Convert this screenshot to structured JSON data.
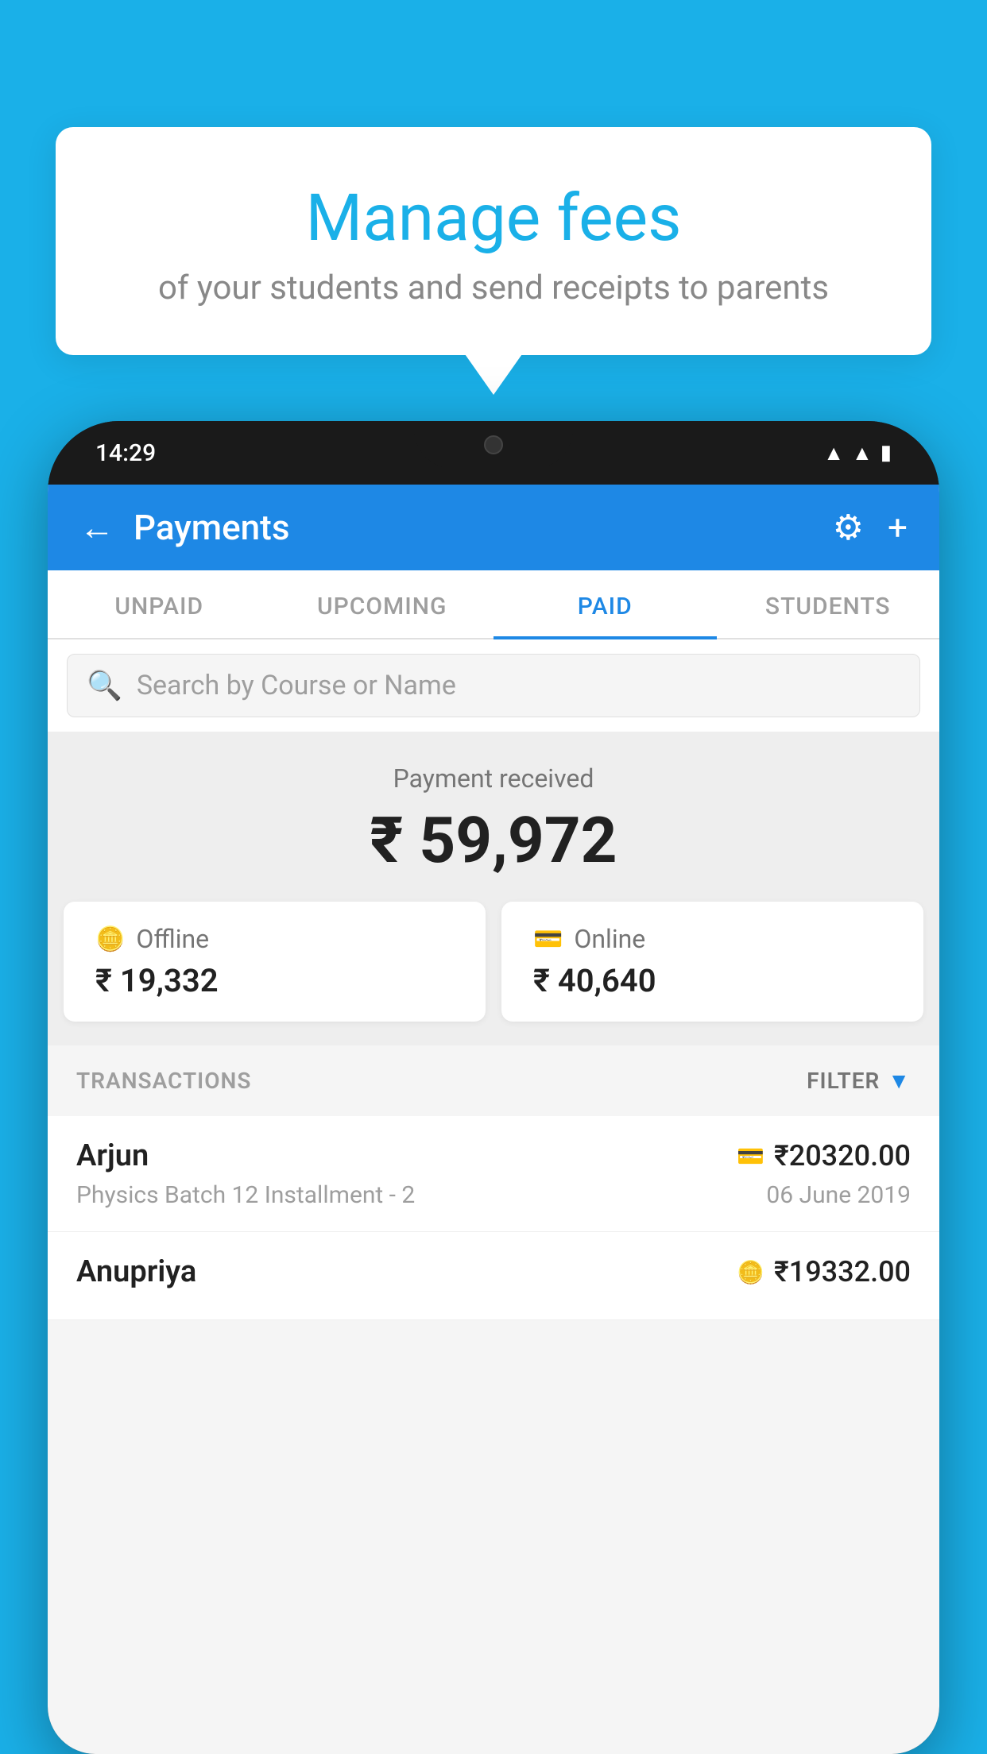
{
  "page": {
    "background_color": "#1ab0e8"
  },
  "tooltip": {
    "title": "Manage fees",
    "subtitle": "of your students and send receipts to parents"
  },
  "status_bar": {
    "time": "14:29"
  },
  "header": {
    "title": "Payments",
    "back_label": "←",
    "settings_label": "⚙",
    "add_label": "+"
  },
  "tabs": [
    {
      "label": "UNPAID",
      "active": false
    },
    {
      "label": "UPCOMING",
      "active": false
    },
    {
      "label": "PAID",
      "active": true
    },
    {
      "label": "STUDENTS",
      "active": false
    }
  ],
  "search": {
    "placeholder": "Search by Course or Name"
  },
  "payment_summary": {
    "label": "Payment received",
    "amount": "₹ 59,972",
    "offline_label": "Offline",
    "offline_amount": "₹ 19,332",
    "online_label": "Online",
    "online_amount": "₹ 40,640"
  },
  "transactions": {
    "header_label": "TRANSACTIONS",
    "filter_label": "FILTER",
    "rows": [
      {
        "name": "Arjun",
        "course": "Physics Batch 12 Installment - 2",
        "amount": "₹20320.00",
        "date": "06 June 2019",
        "type": "online"
      },
      {
        "name": "Anupriya",
        "course": "",
        "amount": "₹19332.00",
        "date": "",
        "type": "offline"
      }
    ]
  }
}
